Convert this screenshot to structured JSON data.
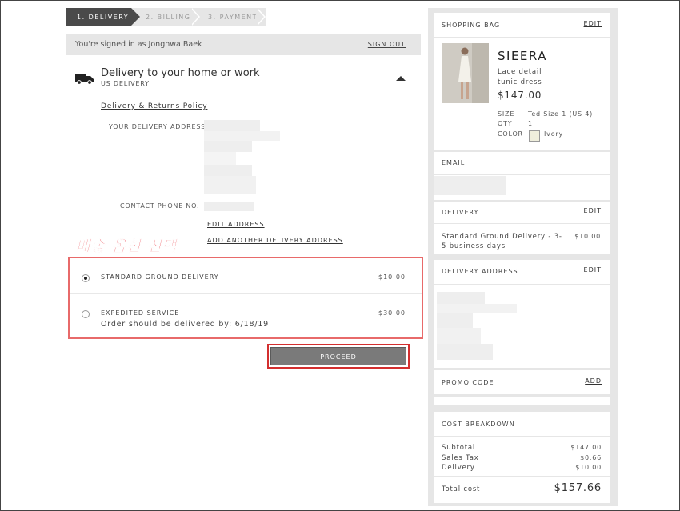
{
  "steps": [
    "1. DELIVERY",
    "2. BILLING",
    "3. PAYMENT"
  ],
  "signin": {
    "text": "You're signed in as Jonghwa Baek",
    "signout": "SIGN OUT"
  },
  "delivery_section": {
    "title": "Delivery to your home or work",
    "subtitle": "US DELIVERY",
    "policy_link": "Delivery & Returns Policy",
    "address_label": "YOUR DELIVERY ADDRESS",
    "phone_label": "CONTACT PHONE NO.",
    "edit_address": "EDIT ADDRESS",
    "add_address": "ADD ANOTHER DELIVERY ADDRESS"
  },
  "annotation": "배송 옵션 선택",
  "options": [
    {
      "label": "STANDARD GROUND DELIVERY",
      "price": "$10.00",
      "selected": true,
      "note": ""
    },
    {
      "label": "EXPEDITED SERVICE",
      "price": "$30.00",
      "selected": false,
      "note": "Order should be delivered by: 6/18/19"
    }
  ],
  "proceed": "PROCEED",
  "sidebar": {
    "bag": {
      "title": "SHOPPING BAG",
      "edit": "EDIT",
      "product": "SIEERA",
      "desc": "Lace detail tunic dress",
      "price": "$147.00",
      "size_label": "SIZE",
      "size": "Ted Size 1 (US 4)",
      "qty_label": "QTY",
      "qty": "1",
      "color_label": "COLOR",
      "color": "Ivory",
      "swatch": "#efeedc"
    },
    "email": {
      "title": "EMAIL"
    },
    "delivery": {
      "title": "DELIVERY",
      "edit": "EDIT",
      "method_line1": "Standard Ground Delivery - 3-",
      "method_line2": "5 business days",
      "price": "$10.00"
    },
    "address": {
      "title": "DELIVERY ADDRESS",
      "edit": "EDIT"
    },
    "promo": {
      "title": "PROMO CODE",
      "add": "ADD"
    },
    "cost": {
      "title": "COST BREAKDOWN",
      "rows": [
        {
          "label": "Subtotal",
          "value": "$147.00"
        },
        {
          "label": "Sales Tax",
          "value": "$0.66"
        },
        {
          "label": "Delivery",
          "value": "$10.00"
        }
      ],
      "total_label": "Total cost",
      "total": "$157.66"
    }
  },
  "colors": {
    "accent_red": "#e8343d",
    "dark": "#4a4a4a",
    "button": "#7a7a7a",
    "panel": "#e6e6e6"
  }
}
